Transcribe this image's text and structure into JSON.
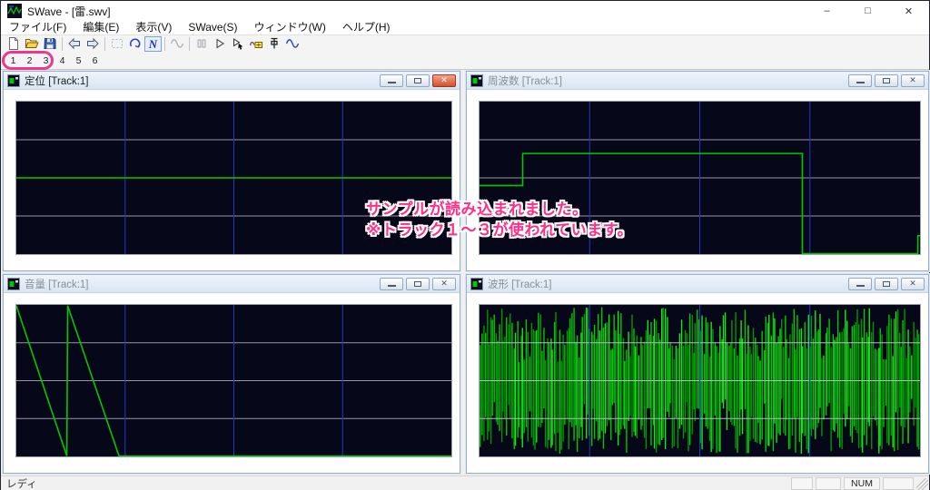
{
  "window": {
    "title": "SWave - [雷.swv]",
    "controls": {
      "minimize": "–",
      "maximize": "□",
      "close": "✕"
    }
  },
  "menu": {
    "items": [
      "ファイル(F)",
      "編集(E)",
      "表示(V)",
      "SWave(S)",
      "ウィンドウ(W)",
      "ヘルプ(H)"
    ]
  },
  "toolbar": {
    "icons": [
      "new-file",
      "open-file",
      "save-file",
      "back-arrow",
      "forward-arrow",
      "select-rectangle",
      "rotate-tool",
      "line-tool-n",
      "sine-tool-disabled",
      "pause-disabled",
      "play",
      "play-cursor",
      "wave-insert-box",
      "pin-tool",
      "sine-tool"
    ],
    "n_tool_glyph": "N"
  },
  "track_buttons": [
    "1",
    "2",
    "3",
    "4",
    "5",
    "6"
  ],
  "icons": {
    "close_glyph": "✕"
  },
  "annotations": {
    "ring_color": "#f1368e",
    "text_color": "#ff2e8b",
    "line1": "サンプルが読み込まれました。",
    "line2": "※トラック１～３が使われています。"
  },
  "windows": [
    {
      "title": "定位 [Track:1]",
      "active": true
    },
    {
      "title": "周波数 [Track:1]",
      "active": false
    },
    {
      "title": "音量 [Track:1]",
      "active": false
    },
    {
      "title": "波形 [Track:1]",
      "active": false
    }
  ],
  "chart_data": [
    {
      "name": "定位 (pan)",
      "type": "line",
      "note": "normalized coords, x 0-1 left-right, y 0=top 1=bottom; flat center line = pan centered",
      "points": [
        [
          0,
          0.5
        ],
        [
          1,
          0.5
        ]
      ],
      "line_color": "#00c800",
      "bg": "#07071a",
      "grid_h": [
        0.25,
        0.5,
        0.75
      ],
      "grid_v": [
        0.25,
        0.5,
        0.75
      ],
      "grid_h_color": "#96969e",
      "grid_v_color": "#2336c8"
    },
    {
      "name": "周波数 (frequency)",
      "type": "line",
      "note": "step function: low start, step up at x=0.098, high plateau, drop to bottom at x=0.733, small rise at right edge",
      "points": [
        [
          0,
          0.55
        ],
        [
          0.098,
          0.55
        ],
        [
          0.098,
          0.34
        ],
        [
          0.733,
          0.34
        ],
        [
          0.733,
          0.997
        ],
        [
          0.995,
          0.997
        ],
        [
          0.995,
          0.88
        ],
        [
          1,
          0.88
        ]
      ],
      "line_color": "#00c800",
      "bg": "#07071a",
      "grid_h": [
        0.25,
        0.5,
        0.75
      ],
      "grid_v": [
        0.25,
        0.5,
        0.75
      ],
      "grid_h_color": "#96969e",
      "grid_v_color": "#2336c8"
    },
    {
      "name": "音量 (volume)",
      "type": "line",
      "note": "two sawtooth ramps from max to zero ending at x=0.116 and x=0.236, then flat at zero",
      "points": [
        [
          0,
          0.005
        ],
        [
          0.116,
          0.997
        ],
        [
          0.118,
          0.005
        ],
        [
          0.236,
          0.997
        ],
        [
          1,
          0.997
        ]
      ],
      "line_color": "#00c800",
      "bg": "#07071a",
      "grid_h": [
        0.25,
        0.5,
        0.75
      ],
      "grid_v": [
        0.25,
        0.5,
        0.75
      ],
      "grid_h_color": "#96969e",
      "grid_v_color": "#2336c8"
    },
    {
      "name": "波形 (waveform)",
      "type": "noise",
      "note": "dense full-height green noise waveform (thunder sample)",
      "strokes": 250,
      "seed": 1337,
      "amp_min": 0.18,
      "amp_max": 0.97,
      "colors": [
        "#009600",
        "#00c800",
        "#19e619"
      ],
      "bg": "#07071a",
      "grid_h": [
        0.25,
        0.5,
        0.75
      ],
      "grid_v": [
        0.25,
        0.5,
        0.75
      ],
      "grid_h_color": "#b9b9c2",
      "grid_v_color": "#2336c8",
      "grid_over_data": true
    }
  ],
  "status_bar": {
    "ready_text": "レディ",
    "num_label": "NUM"
  }
}
